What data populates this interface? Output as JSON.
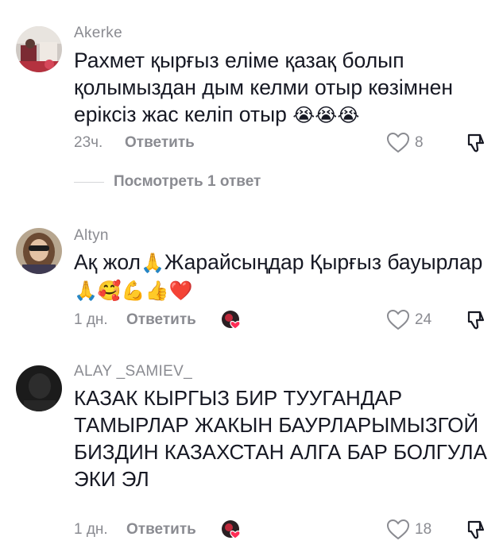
{
  "comments": [
    {
      "username": "Akerke",
      "text": "Рахмет қырғыз еліме қазақ болып қолымыздан дым келми отыр көзімнен еріксіз жас келіп отыр",
      "emojis": "😭😭😭",
      "time": "23ч.",
      "reply_label": "Ответить",
      "likes": "8",
      "view_replies_label": "Посмотреть 1 ответ"
    },
    {
      "username": "Altyn",
      "text_part1": "Ақ жол",
      "emoji1": "🙏",
      "text_part2": "Жарайсыңдар Қырғыз бауырлар",
      "emojis2": "🙏🥰💪👍❤️",
      "time": "1 дн.",
      "reply_label": "Ответить",
      "likes": "24"
    },
    {
      "username": "ALAY _SAMIEV_",
      "text": "КАЗАК КЫРГЫЗ БИР ТУУГАНДАР ТАМЫРЛАР ЖАКЫН БАУРЛАРЫМЫЗГОЙ БИЗДИН КАЗАХСТАН АЛГА БАР БОЛГУЛА ЭКИ ЭЛ",
      "time": "1 дн.",
      "reply_label": "Ответить",
      "likes": "18"
    }
  ],
  "colors": {
    "text": "#161823",
    "meta": "#8a8b91",
    "heart_badge": "#fe2c55"
  },
  "icons": [
    "heart-outline-icon",
    "dislike-icon",
    "creator-liked-icon"
  ]
}
